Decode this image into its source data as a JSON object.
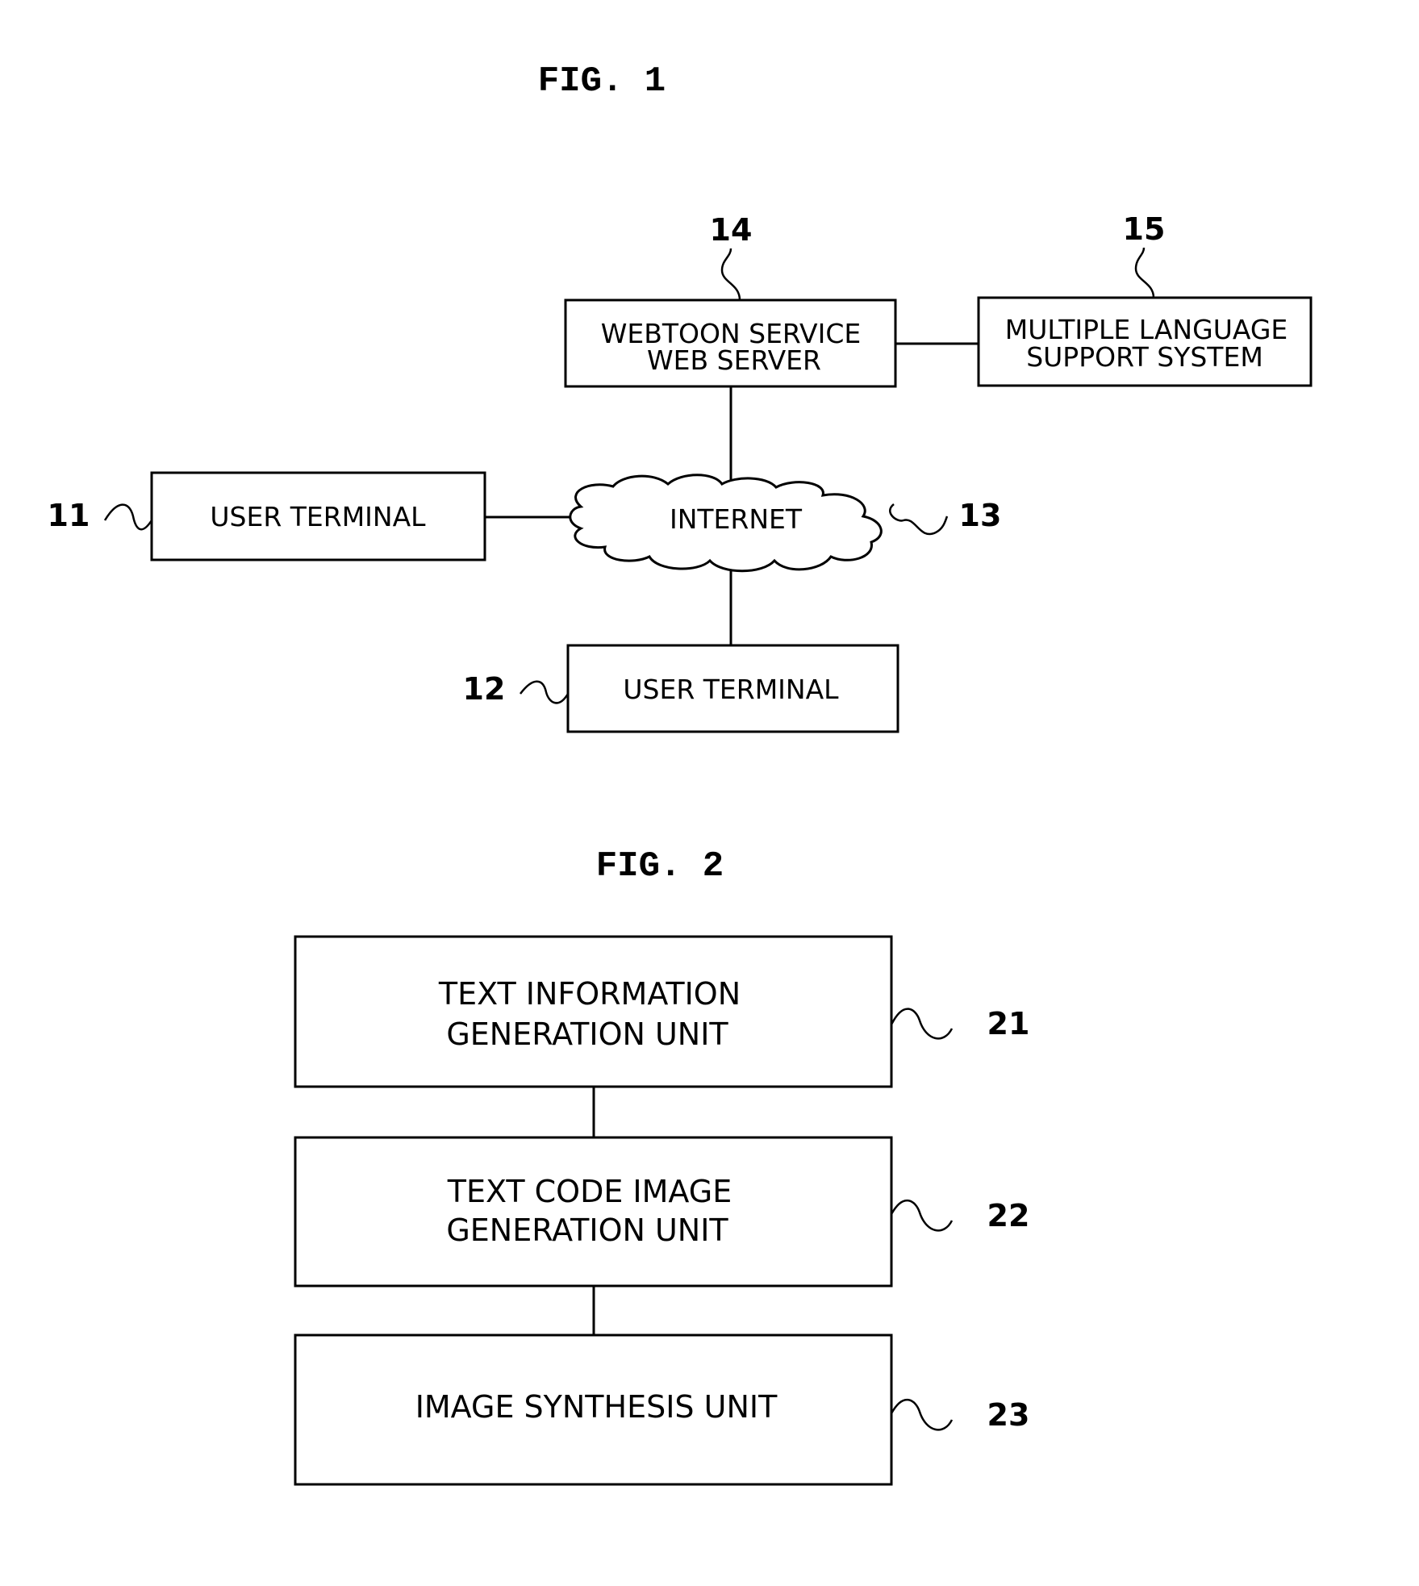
{
  "figures": [
    {
      "title": "FIG. 1",
      "nodes": {
        "web_server": {
          "ref": "14",
          "lines": [
            "WEBTOON SERVICE",
            "WEB SERVER"
          ]
        },
        "language_system": {
          "ref": "15",
          "lines": [
            "MULTIPLE LANGUAGE",
            "SUPPORT SYSTEM"
          ]
        },
        "user_terminal_1": {
          "ref": "11",
          "lines": [
            "USER TERMINAL"
          ]
        },
        "internet": {
          "ref": "13",
          "lines": [
            "INTERNET"
          ]
        },
        "user_terminal_2": {
          "ref": "12",
          "lines": [
            "USER TERMINAL"
          ]
        }
      },
      "connections": [
        [
          "web_server",
          "language_system"
        ],
        [
          "web_server",
          "internet"
        ],
        [
          "user_terminal_1",
          "internet"
        ],
        [
          "internet",
          "user_terminal_2"
        ]
      ]
    },
    {
      "title": "FIG. 2",
      "nodes": {
        "text_info_unit": {
          "ref": "21",
          "lines": [
            "TEXT INFORMATION",
            "GENERATION UNIT"
          ]
        },
        "text_code_unit": {
          "ref": "22",
          "lines": [
            "TEXT CODE IMAGE",
            "GENERATION UNIT"
          ]
        },
        "image_synthesis_unit": {
          "ref": "23",
          "lines": [
            "IMAGE SYNTHESIS UNIT"
          ]
        }
      },
      "connections": [
        [
          "text_info_unit",
          "text_code_unit"
        ],
        [
          "text_code_unit",
          "image_synthesis_unit"
        ]
      ]
    }
  ]
}
